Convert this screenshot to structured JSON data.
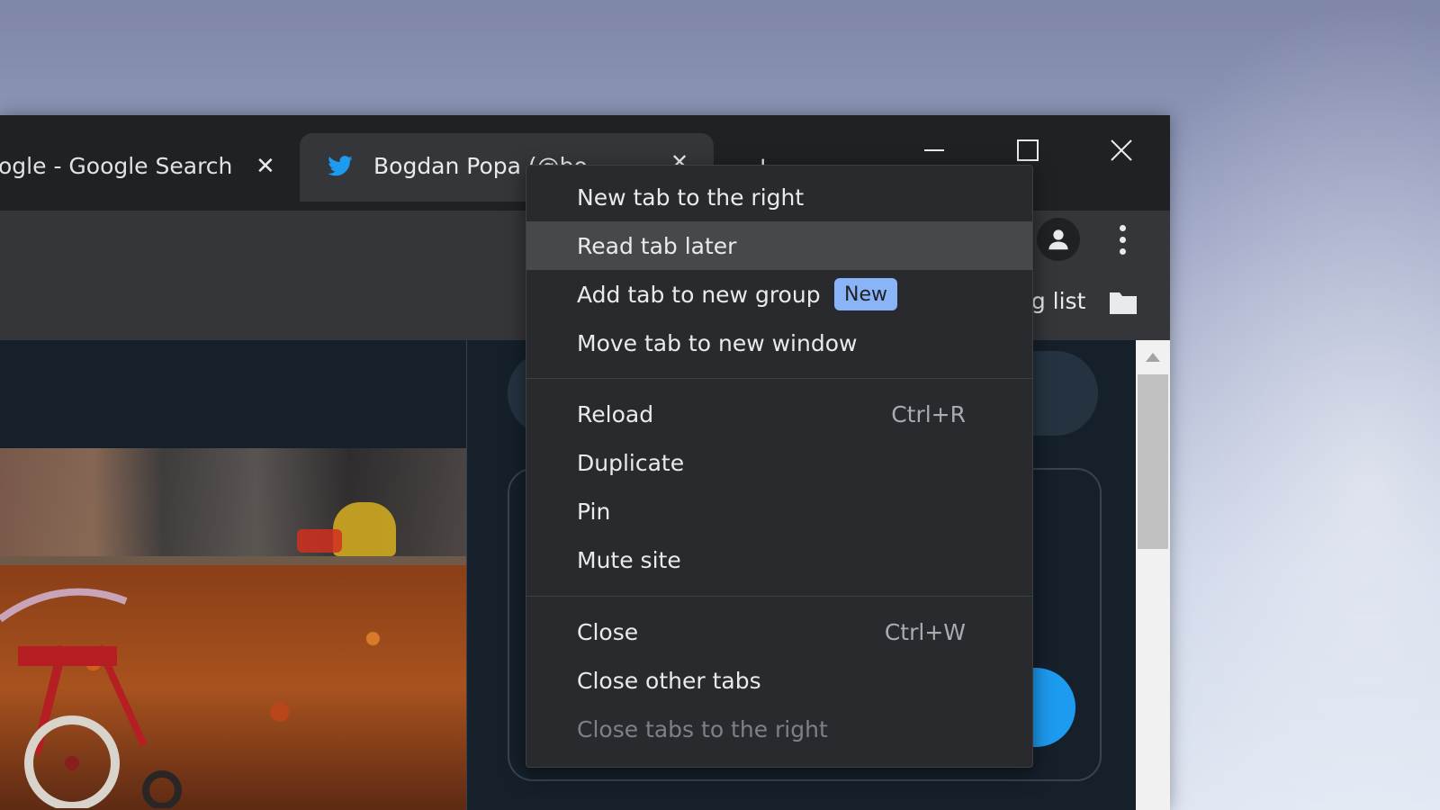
{
  "browser": {
    "tabs": [
      {
        "title": "ogle - Google Search",
        "active": false
      },
      {
        "title": "Bogdan Popa (@bo",
        "active": true,
        "icon": "twitter-bird-icon"
      }
    ],
    "new_tab_glyph": "+",
    "window_controls": {
      "minimize": "minimize-icon",
      "maximize": "maximize-icon",
      "close": "close-icon"
    }
  },
  "toolbar": {
    "avatar_icon": "profile-avatar-icon",
    "menu_icon": "three-dot-menu-icon"
  },
  "bookmarks": {
    "reading_list_label": "ng list",
    "reading_list_icon": "folder-icon"
  },
  "context_menu": {
    "items": [
      {
        "label": "New tab to the right"
      },
      {
        "label": "Read tab later",
        "highlighted": true
      },
      {
        "label": "Add tab to new group",
        "badge": "New"
      },
      {
        "label": "Move tab to new window"
      },
      {
        "label": "Reload",
        "shortcut": "Ctrl+R"
      },
      {
        "label": "Duplicate"
      },
      {
        "label": "Pin"
      },
      {
        "label": "Mute site"
      },
      {
        "label": "Close",
        "shortcut": "Ctrl+W"
      },
      {
        "label": "Close other tabs"
      },
      {
        "label": "Close tabs to the right",
        "disabled": true
      }
    ]
  },
  "colors": {
    "tab_bar": "#202124",
    "active_tab": "#35363a",
    "menu_bg": "#292a2d",
    "menu_highlight": "#47484b",
    "badge_bg": "#8ab4f8",
    "twitter_blue": "#1d9bf0",
    "page_bg": "#15202b"
  }
}
